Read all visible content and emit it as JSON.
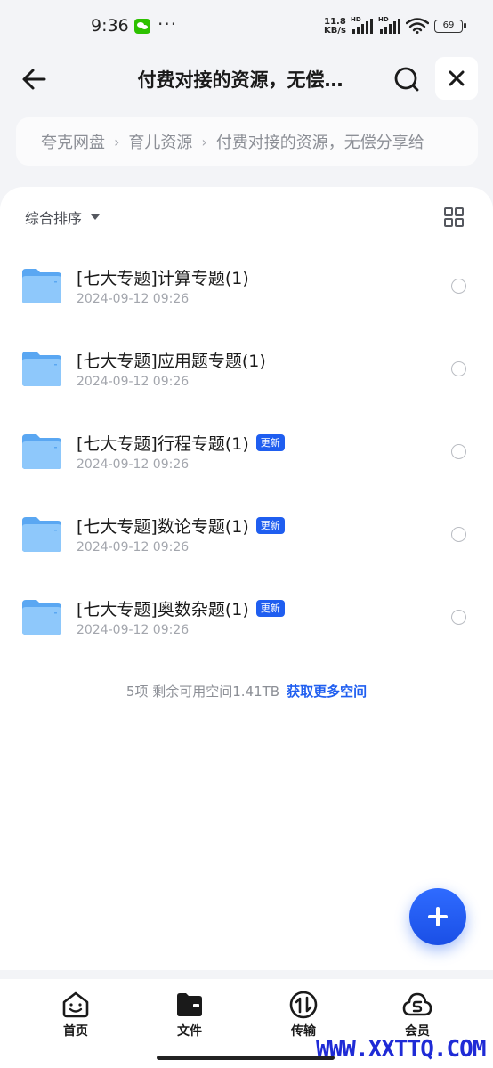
{
  "status_bar": {
    "time": "9:36",
    "net_speed_value": "11.8",
    "net_speed_unit": "KB/s",
    "hd_label": "HD",
    "battery": "69"
  },
  "header": {
    "title": "付费对接的资源，无偿…"
  },
  "breadcrumb": {
    "items": [
      "夸克网盘",
      "育儿资源",
      "付费对接的资源，无偿分享给"
    ],
    "separator": "›"
  },
  "toolbar": {
    "sort_label": "综合排序"
  },
  "files": [
    {
      "name": "[七大专题]计算专题(1)",
      "date": "2024-09-12 09:26",
      "badge": ""
    },
    {
      "name": "[七大专题]应用题专题(1)",
      "date": "2024-09-12 09:26",
      "badge": ""
    },
    {
      "name": "[七大专题]行程专题(1)",
      "date": "2024-09-12 09:26",
      "badge": "更新"
    },
    {
      "name": "[七大专题]数论专题(1)",
      "date": "2024-09-12 09:26",
      "badge": "更新"
    },
    {
      "name": "[七大专题]奥数杂题(1)",
      "date": "2024-09-12 09:26",
      "badge": "更新"
    }
  ],
  "summary": {
    "text": "5项 剩余可用空间1.41TB",
    "link": "获取更多空间"
  },
  "bottom_nav": [
    {
      "label": "首页",
      "icon": "home-face-icon"
    },
    {
      "label": "文件",
      "icon": "folder-icon",
      "active": true
    },
    {
      "label": "传输",
      "icon": "transfer-icon"
    },
    {
      "label": "会员",
      "icon": "cloud-member-icon"
    }
  ],
  "watermark": "WWW.XXTTQ.COM",
  "colors": {
    "accent": "#1f5ef0",
    "badge_bg": "#1f5ef0",
    "folder": "#6cb6f7",
    "page_bg": "#f3f4f7"
  }
}
